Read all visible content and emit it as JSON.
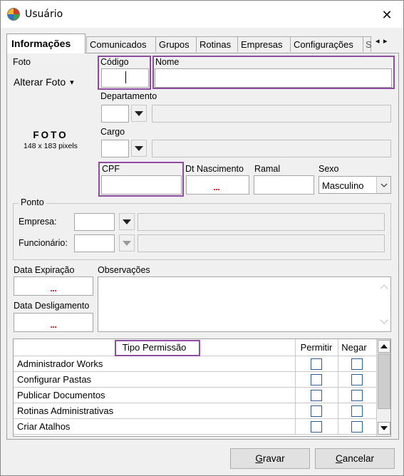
{
  "window": {
    "title": "Usuário",
    "close_glyph": "✕",
    "icon": "app-logo-icon"
  },
  "tabs": [
    "Informações",
    "Comunicados",
    "Grupos",
    "Rotinas",
    "Empresas",
    "Configurações",
    "S"
  ],
  "tab_nav": {
    "left": "◂",
    "right": "▸"
  },
  "foto": {
    "label": "Foto",
    "button": "Alterar Foto",
    "button_caret": "▾",
    "title": "FOTO",
    "size": "148 x 183 pixels"
  },
  "fields": {
    "codigo": {
      "label": "Código",
      "value": ""
    },
    "nome": {
      "label": "Nome",
      "value": ""
    },
    "departamento": {
      "label": "Departamento",
      "code": "",
      "name": ""
    },
    "cargo": {
      "label": "Cargo",
      "code": "",
      "name": ""
    },
    "cpf": {
      "label": "CPF",
      "value": ""
    },
    "dt_nascimento": {
      "label": "Dt Nascimento",
      "value": ""
    },
    "ramal": {
      "label": "Ramal",
      "value": ""
    },
    "sexo": {
      "label": "Sexo",
      "value": "Masculino"
    }
  },
  "ponto": {
    "title": "Ponto",
    "empresa": {
      "label": "Empresa:",
      "code": "",
      "name": ""
    },
    "funcionario": {
      "label": "Funcionário:",
      "code": "",
      "name": ""
    }
  },
  "data_expiracao": {
    "label": "Data Expiração",
    "value": ""
  },
  "data_desligamento": {
    "label": "Data Desligamento",
    "value": ""
  },
  "observacoes": {
    "label": "Observações",
    "value": ""
  },
  "permissions": {
    "headers": {
      "tipo": "Tipo Permissão",
      "permitir": "Permitir",
      "negar": "Negar"
    },
    "rows": [
      {
        "name": "Administrador Works",
        "permitir": false,
        "negar": false
      },
      {
        "name": "Configurar Pastas",
        "permitir": false,
        "negar": false
      },
      {
        "name": "Publicar Documentos",
        "permitir": false,
        "negar": false
      },
      {
        "name": "Rotinas Administrativas",
        "permitir": false,
        "negar": false
      },
      {
        "name": "Criar Atalhos",
        "permitir": false,
        "negar": false
      }
    ]
  },
  "footer": {
    "save": "Gravar",
    "save_mnemonic": "G",
    "save_rest": "ravar",
    "cancel": "Cancelar",
    "cancel_mnemonic": "C",
    "cancel_rest": "ancelar"
  },
  "colors": {
    "highlight": "#8e4c9f",
    "checkbox_border": "#2b5d94",
    "spell_mark": "#e03030"
  }
}
